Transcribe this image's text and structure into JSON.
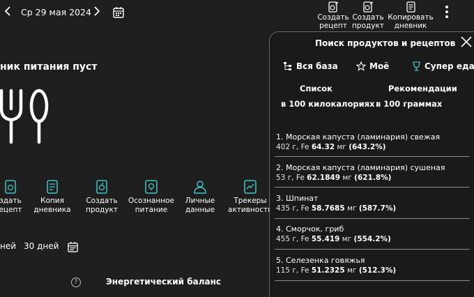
{
  "header": {
    "date": "Ср 29 мая 2024",
    "actions": [
      {
        "label": "Создать\nрецепт"
      },
      {
        "label": "Создать\nпродукт"
      },
      {
        "label": "Копировать\nдневник"
      }
    ]
  },
  "diary": {
    "empty_title": "ник питания пуст",
    "features": [
      {
        "label": "здать\nецепт"
      },
      {
        "label": "Копия\nдневника"
      },
      {
        "label": "Создать\nпродукт"
      },
      {
        "label": "Осознанное\nпитание"
      },
      {
        "label": "Личные\nданные"
      },
      {
        "label": "Трекеры\nактивности"
      }
    ],
    "periods": [
      "ней",
      "30 дней"
    ],
    "energy_title": "Энергетический баланс",
    "help_symbol": "?"
  },
  "panel": {
    "title": "Поиск продуктов и рецептов",
    "filters": [
      "Вся база",
      "Моё",
      "Супер еда"
    ],
    "columns": [
      {
        "line1": "Список",
        "line2": "в 100 килокалориях"
      },
      {
        "line1": "Рекомендации",
        "line2": "в 100 граммах"
      }
    ],
    "results": [
      {
        "name": "1. Морская капуста (ламинария) свежая",
        "weight": "402 г, Fe",
        "amount": "64.32",
        "unit": "мг",
        "percent": "(643.2%)"
      },
      {
        "name": "2. Морская капуста (ламинария) сушеная",
        "weight": "53 г, Fe",
        "amount": "62.1849",
        "unit": "мг",
        "percent": "(621.8%)"
      },
      {
        "name": "3. Шпинат",
        "weight": "435 г, Fe",
        "amount": "58.7685",
        "unit": "мг",
        "percent": "(587.7%)"
      },
      {
        "name": "4. Сморчок, гриб",
        "weight": "455 г, Fe",
        "amount": "55.419",
        "unit": "мг",
        "percent": "(554.2%)"
      },
      {
        "name": "5. Селезенка говяжья",
        "weight": "115 г, Fe",
        "amount": "51.2325",
        "unit": "мг",
        "percent": "(512.3%)"
      }
    ]
  },
  "colors": {
    "background": "#1e1e1e",
    "panel_background": "#1a1a1a",
    "text": "#ffffff",
    "accent": "#3ec6c6",
    "divider": "#8a8a8a"
  }
}
